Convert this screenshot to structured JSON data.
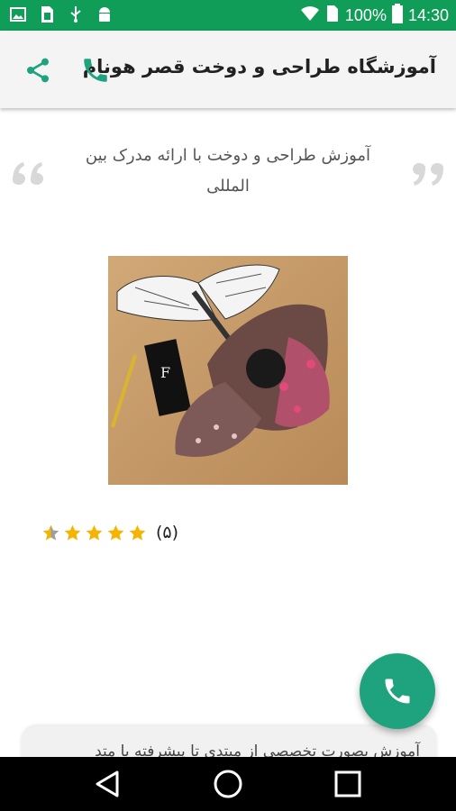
{
  "status_bar": {
    "battery": "100%",
    "time": "14:30",
    "left_icons": [
      "image-icon",
      "sim-icon",
      "usb-icon",
      "android-icon"
    ],
    "right_icons": [
      "wifi-icon",
      "signal-icon",
      "battery-icon"
    ]
  },
  "toolbar": {
    "title": "آموزشگاه طراحی و دوخت قصر هونام",
    "share_icon": "share-icon",
    "call_icon": "phone-icon"
  },
  "quote": {
    "text": "آموزش طراحی و دوخت با ارائه مدرک بین المللی"
  },
  "photo": {
    "subject": "embroidered-moth-brooch"
  },
  "rating": {
    "value": 4.5,
    "max": 5,
    "count_label": "(۵)"
  },
  "card": {
    "text": "آموزش بصورت تخصصی از مبتدی تا پیشرفته با متد"
  },
  "fab": {
    "icon": "phone-icon"
  },
  "navbar": {
    "icons": [
      "back-icon",
      "home-icon",
      "recents-icon"
    ]
  },
  "colors": {
    "status_bar": "#0f9d58",
    "accent": "#1fa37f",
    "star": "#f4b400"
  }
}
